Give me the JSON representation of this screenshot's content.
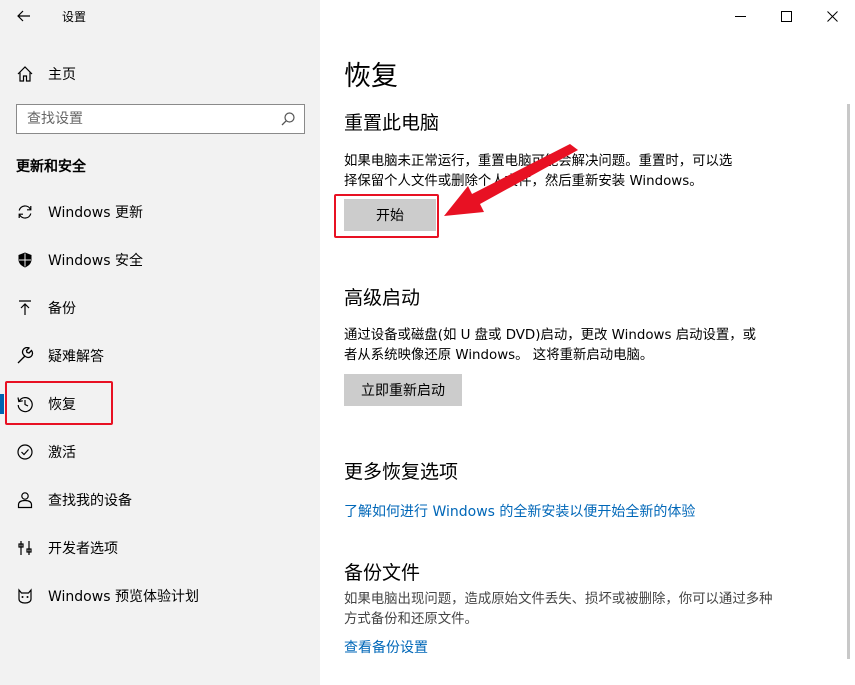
{
  "app_title": "设置",
  "sidebar": {
    "home_label": "主页",
    "search_placeholder": "查找设置",
    "section_heading": "更新和安全",
    "items": [
      {
        "label": "Windows 更新",
        "icon": "sync-icon"
      },
      {
        "label": "Windows 安全",
        "icon": "shield-icon"
      },
      {
        "label": "备份",
        "icon": "upload-arrow-icon"
      },
      {
        "label": "疑难解答",
        "icon": "wrench-icon"
      },
      {
        "label": "恢复",
        "icon": "history-icon",
        "selected": true
      },
      {
        "label": "激活",
        "icon": "check-circle-icon"
      },
      {
        "label": "查找我的设备",
        "icon": "person-location-icon"
      },
      {
        "label": "开发者选项",
        "icon": "tools-icon"
      },
      {
        "label": "Windows 预览体验计划",
        "icon": "insider-cat-icon"
      }
    ]
  },
  "main": {
    "title": "恢复",
    "reset": {
      "title": "重置此电脑",
      "desc_line1": "如果电脑未正常运行，重置电脑可能会解决问题。重置时，可以选",
      "desc_line2": "择保留个人文件或删除个人文件，然后重新安装 Windows。",
      "button": "开始"
    },
    "advanced": {
      "title": "高级启动",
      "desc_line1": "通过设备或磁盘(如 U 盘或 DVD)启动，更改 Windows 启动设置，或",
      "desc_line2": "者从系统映像还原 Windows。 这将重新启动电脑。",
      "button": "立即重新启动"
    },
    "more": {
      "title": "更多恢复选项",
      "link": "了解如何进行 Windows 的全新安装以便开始全新的体验"
    },
    "backup": {
      "title": "备份文件",
      "desc_line1": "如果电脑出现问题，造成原始文件丢失、损坏或被删除，你可以通过多种",
      "desc_line2": "方式备份和还原文件。",
      "link": "查看备份设置"
    }
  },
  "colors": {
    "accent": "#0063b1",
    "link": "#0067b8",
    "annotation_red": "#e81123",
    "sidebar_bg": "#f2f2f2",
    "button_bg": "#cccccc"
  }
}
